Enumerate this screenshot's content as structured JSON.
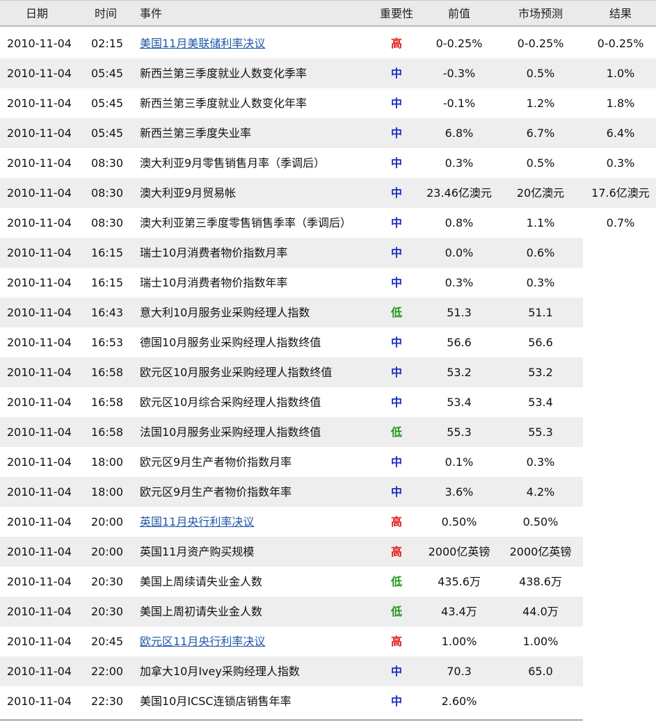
{
  "header": {
    "date": "日期",
    "time": "时间",
    "event": "事件",
    "importance": "重要性",
    "previous": "前值",
    "forecast": "市场预测",
    "result": "结果"
  },
  "colors": {
    "high": "#e01c1c",
    "mid": "#1a2fc9",
    "low": "#1c9a1c",
    "link": "#1f57a8"
  },
  "rows": [
    {
      "date": "2010-11-04",
      "time": "02:15",
      "event": "美国11月美联储利率决议",
      "link": true,
      "importance": "高",
      "level": "high",
      "previous": "0-0.25%",
      "forecast": "0-0.25%",
      "result": "0-0.25%"
    },
    {
      "date": "2010-11-04",
      "time": "05:45",
      "event": "新西兰第三季度就业人数变化季率",
      "link": false,
      "importance": "中",
      "level": "mid",
      "previous": "-0.3%",
      "forecast": "0.5%",
      "result": "1.0%"
    },
    {
      "date": "2010-11-04",
      "time": "05:45",
      "event": "新西兰第三季度就业人数变化年率",
      "link": false,
      "importance": "中",
      "level": "mid",
      "previous": "-0.1%",
      "forecast": "1.2%",
      "result": "1.8%"
    },
    {
      "date": "2010-11-04",
      "time": "05:45",
      "event": "新西兰第三季度失业率",
      "link": false,
      "importance": "中",
      "level": "mid",
      "previous": "6.8%",
      "forecast": "6.7%",
      "result": "6.4%"
    },
    {
      "date": "2010-11-04",
      "time": "08:30",
      "event": "澳大利亚9月零售销售月率（季调后）",
      "link": false,
      "importance": "中",
      "level": "mid",
      "previous": "0.3%",
      "forecast": "0.5%",
      "result": "0.3%"
    },
    {
      "date": "2010-11-04",
      "time": "08:30",
      "event": "澳大利亚9月贸易帐",
      "link": false,
      "importance": "中",
      "level": "mid",
      "previous": "23.46亿澳元",
      "forecast": "20亿澳元",
      "result": "17.6亿澳元"
    },
    {
      "date": "2010-11-04",
      "time": "08:30",
      "event": "澳大利亚第三季度零售销售季率（季调后）",
      "link": false,
      "importance": "中",
      "level": "mid",
      "previous": "0.8%",
      "forecast": "1.1%",
      "result": "0.7%"
    },
    {
      "date": "2010-11-04",
      "time": "16:15",
      "event": "瑞士10月消费者物价指数月率",
      "link": false,
      "importance": "中",
      "level": "mid",
      "previous": "0.0%",
      "forecast": "0.6%",
      "result": ""
    },
    {
      "date": "2010-11-04",
      "time": "16:15",
      "event": "瑞士10月消费者物价指数年率",
      "link": false,
      "importance": "中",
      "level": "mid",
      "previous": "0.3%",
      "forecast": "0.3%",
      "result": ""
    },
    {
      "date": "2010-11-04",
      "time": "16:43",
      "event": "意大利10月服务业采购经理人指数",
      "link": false,
      "importance": "低",
      "level": "low",
      "previous": "51.3",
      "forecast": "51.1",
      "result": ""
    },
    {
      "date": "2010-11-04",
      "time": "16:53",
      "event": "德国10月服务业采购经理人指数终值",
      "link": false,
      "importance": "中",
      "level": "mid",
      "previous": "56.6",
      "forecast": "56.6",
      "result": ""
    },
    {
      "date": "2010-11-04",
      "time": "16:58",
      "event": "欧元区10月服务业采购经理人指数终值",
      "link": false,
      "importance": "中",
      "level": "mid",
      "previous": "53.2",
      "forecast": "53.2",
      "result": ""
    },
    {
      "date": "2010-11-04",
      "time": "16:58",
      "event": "欧元区10月综合采购经理人指数终值",
      "link": false,
      "importance": "中",
      "level": "mid",
      "previous": "53.4",
      "forecast": "53.4",
      "result": ""
    },
    {
      "date": "2010-11-04",
      "time": "16:58",
      "event": "法国10月服务业采购经理人指数终值",
      "link": false,
      "importance": "低",
      "level": "low",
      "previous": "55.3",
      "forecast": "55.3",
      "result": ""
    },
    {
      "date": "2010-11-04",
      "time": "18:00",
      "event": "欧元区9月生产者物价指数月率",
      "link": false,
      "importance": "中",
      "level": "mid",
      "previous": "0.1%",
      "forecast": "0.3%",
      "result": ""
    },
    {
      "date": "2010-11-04",
      "time": "18:00",
      "event": "欧元区9月生产者物价指数年率",
      "link": false,
      "importance": "中",
      "level": "mid",
      "previous": "3.6%",
      "forecast": "4.2%",
      "result": ""
    },
    {
      "date": "2010-11-04",
      "time": "20:00",
      "event": "英国11月央行利率决议",
      "link": true,
      "importance": "高",
      "level": "high",
      "previous": "0.50%",
      "forecast": "0.50%",
      "result": ""
    },
    {
      "date": "2010-11-04",
      "time": "20:00",
      "event": "英国11月资产购买规模",
      "link": false,
      "importance": "高",
      "level": "high",
      "previous": "2000亿英镑",
      "forecast": "2000亿英镑",
      "result": ""
    },
    {
      "date": "2010-11-04",
      "time": "20:30",
      "event": "美国上周续请失业金人数",
      "link": false,
      "importance": "低",
      "level": "low",
      "previous": "435.6万",
      "forecast": "438.6万",
      "result": ""
    },
    {
      "date": "2010-11-04",
      "time": "20:30",
      "event": "美国上周初请失业金人数",
      "link": false,
      "importance": "低",
      "level": "low",
      "previous": "43.4万",
      "forecast": "44.0万",
      "result": ""
    },
    {
      "date": "2010-11-04",
      "time": "20:45",
      "event": "欧元区11月央行利率决议",
      "link": true,
      "importance": "高",
      "level": "high",
      "previous": "1.00%",
      "forecast": "1.00%",
      "result": ""
    },
    {
      "date": "2010-11-04",
      "time": "22:00",
      "event": "加拿大10月Ivey采购经理人指数",
      "link": false,
      "importance": "中",
      "level": "mid",
      "previous": "70.3",
      "forecast": "65.0",
      "result": ""
    },
    {
      "date": "2010-11-04",
      "time": "22:30",
      "event": "美国10月ICSC连锁店销售年率",
      "link": false,
      "importance": "中",
      "level": "mid",
      "previous": "2.60%",
      "forecast": "",
      "result": ""
    }
  ]
}
